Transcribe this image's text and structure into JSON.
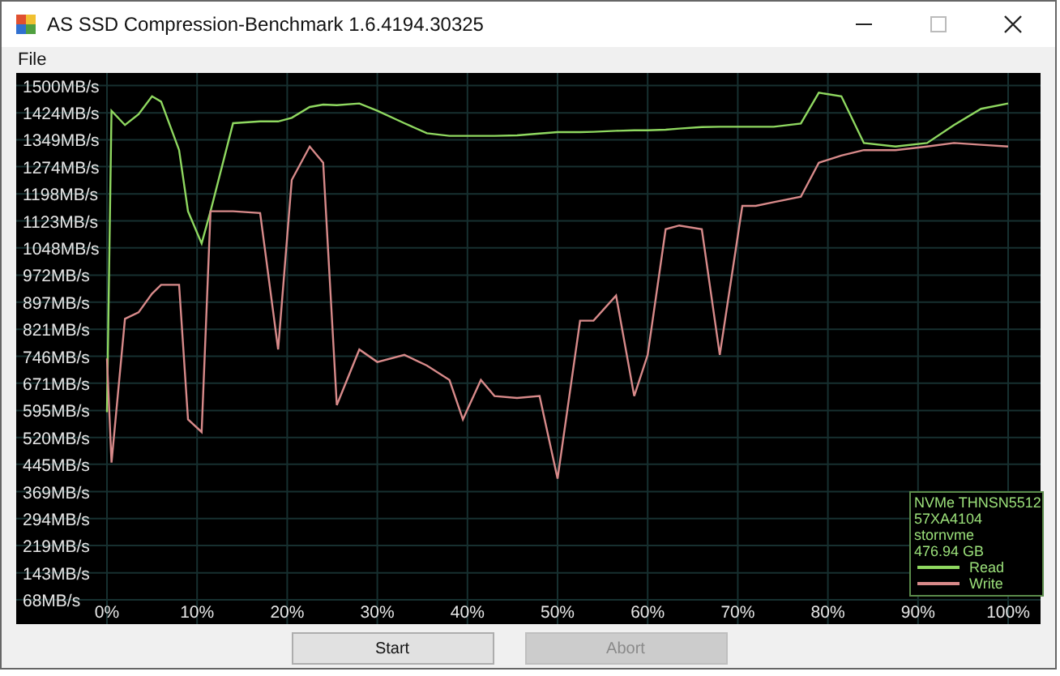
{
  "window": {
    "title": "AS SSD Compression-Benchmark 1.6.4194.30325"
  },
  "menu": [
    {
      "label": "File"
    }
  ],
  "chart": {
    "legend": [
      "NVMe THNSN5512",
      "57XA4104",
      "stornvme",
      "476.94 GB"
    ],
    "chart_data": {
      "type": "line",
      "grid": true,
      "xlim": [
        0,
        100
      ],
      "ylim": [
        0,
        1535
      ],
      "xticks": [
        {
          "value": 0,
          "label": "0%"
        },
        {
          "value": 10,
          "label": "10%"
        },
        {
          "value": 20,
          "label": "20%"
        },
        {
          "value": 30,
          "label": "30%"
        },
        {
          "value": 40,
          "label": "40%"
        },
        {
          "value": 50,
          "label": "50%"
        },
        {
          "value": 60,
          "label": "60%"
        },
        {
          "value": 70,
          "label": "70%"
        },
        {
          "value": 80,
          "label": "80%"
        },
        {
          "value": 90,
          "label": "90%"
        },
        {
          "value": 100,
          "label": "100%"
        }
      ],
      "yticks": [
        {
          "value": 1500,
          "label": "1500MB/s"
        },
        {
          "value": 1424,
          "label": "1424MB/s"
        },
        {
          "value": 1349,
          "label": "1349MB/s"
        },
        {
          "value": 1274,
          "label": "1274MB/s"
        },
        {
          "value": 1198,
          "label": "1198MB/s"
        },
        {
          "value": 1123,
          "label": "1123MB/s"
        },
        {
          "value": 1048,
          "label": "1048MB/s"
        },
        {
          "value": 972,
          "label": "972MB/s"
        },
        {
          "value": 897,
          "label": "897MB/s"
        },
        {
          "value": 821,
          "label": "821MB/s"
        },
        {
          "value": 746,
          "label": "746MB/s"
        },
        {
          "value": 671,
          "label": "671MB/s"
        },
        {
          "value": 595,
          "label": "595MB/s"
        },
        {
          "value": 520,
          "label": "520MB/s"
        },
        {
          "value": 445,
          "label": "445MB/s"
        },
        {
          "value": 369,
          "label": "369MB/s"
        },
        {
          "value": 294,
          "label": "294MB/s"
        },
        {
          "value": 219,
          "label": "219MB/s"
        },
        {
          "value": 143,
          "label": "143MB/s"
        },
        {
          "value": 68,
          "label": "68MB/s"
        }
      ],
      "x": [
        0,
        0.5,
        2,
        3.5,
        5,
        6,
        8,
        9,
        10.5,
        11.5,
        14,
        17,
        19,
        20.5,
        22.5,
        24,
        25.5,
        28,
        30,
        33,
        35.5,
        38,
        39.5,
        41.5,
        43,
        45.5,
        48,
        50,
        52.5,
        54,
        56.5,
        58.5,
        60,
        62,
        63.5,
        66,
        68,
        70.5,
        72,
        74,
        77,
        79,
        81.5,
        84,
        87.5,
        91,
        94,
        97,
        100
      ],
      "series": [
        {
          "name": "Read",
          "color": "#8fd860",
          "values": [
            590,
            1430,
            1390,
            1420,
            1470,
            1455,
            1320,
            1150,
            1060,
            1150,
            1395,
            1400,
            1400,
            1410,
            1440,
            1447,
            1445,
            1450,
            1430,
            1395,
            1367,
            1360,
            1360,
            1360,
            1360,
            1361,
            1366,
            1370,
            1370,
            1371,
            1374,
            1375,
            1375,
            1377,
            1380,
            1384,
            1385,
            1385,
            1385,
            1385,
            1394,
            1480,
            1470,
            1340,
            1330,
            1340,
            1390,
            1435,
            1450
          ]
        },
        {
          "name": "Write",
          "color": "#d88a8a",
          "values": [
            740,
            450,
            850,
            868,
            920,
            945,
            945,
            570,
            535,
            1150,
            1150,
            1145,
            765,
            1237,
            1330,
            1285,
            610,
            765,
            730,
            750,
            720,
            680,
            570,
            680,
            635,
            630,
            635,
            405,
            845,
            845,
            915,
            635,
            750,
            1100,
            1110,
            1100,
            750,
            1165,
            1165,
            1175,
            1190,
            1285,
            1305,
            1320,
            1320,
            1330,
            1340,
            1335,
            1330
          ]
        }
      ]
    }
  },
  "buttons": [
    {
      "label": "Start",
      "disabled": false
    },
    {
      "label": "Abort",
      "disabled": true
    }
  ]
}
